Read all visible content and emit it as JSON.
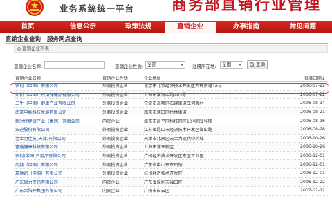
{
  "header": {
    "subtitle": "业务系统统一平台",
    "title": "商务部直销行业管理"
  },
  "nav": {
    "items": [
      {
        "label": "首页",
        "active": false
      },
      {
        "label": "信息公示",
        "active": false
      },
      {
        "label": "政策法规",
        "active": false
      },
      {
        "label": "直销企业",
        "active": true
      },
      {
        "label": "办事指南",
        "active": false
      },
      {
        "label": "常见问题",
        "active": false
      }
    ]
  },
  "section": {
    "title": "直销企业查询 | 服务网点查询",
    "crumb": "直销企业列表"
  },
  "search": {
    "name_label": "直销企业名称:",
    "type_label": "直销企业性质:",
    "type_value": "全部",
    "region_label": "注册所在地:",
    "region_value": "全国",
    "button_label": "查询"
  },
  "table": {
    "headers": [
      "直销企业名称",
      "直销企业性质",
      "企业地址",
      "批准日期↓"
    ],
    "rows": [
      [
        "安利（中国）有限公司",
        "外商投资企业",
        "北京市北京经济技术开发区西环南路18号",
        "2006-07-22"
      ],
      [
        "如新（中国）日用保健品有限公司",
        "外商投资企业",
        "上海市淮海中路283号",
        "2006-07-22"
      ],
      [
        "三生（中国）健康产业有限公司",
        "外商投资企业",
        "宁波市海曙区石碶街道车何渡村",
        "2006-08-14"
      ],
      [
        "南京中脉科技发展有限公司",
        "外商投资企业",
        "南京市浦口区桥林街道",
        "2006-08-21"
      ],
      [
        "新时代健康产业（集团）有限公司",
        "内资企业",
        "北京市昌平区科技园区10号院1号楼",
        "2006-08-16"
      ],
      [
        "双迪股份有限公司",
        "外商投资企业",
        "江苏省昆山市经济技术开发区嵩山路",
        "2006-08-28"
      ],
      [
        "金士力佳友(天津)有限公司",
        "外商投资企业",
        "天津市北辰区天士力现代中药城",
        "2006-10-26"
      ],
      [
        "富迪健康科技有限公司",
        "外商投资企业",
        "上海市浦东新区",
        "2006-10-26"
      ],
      [
        "安利(中国)日用品有限公司",
        "外商投资企业",
        "广州经济技术开发区东区工业区",
        "2006-12-01"
      ],
      [
        "尚赫（中国）有限公司",
        "外商投资企业",
        "广东省中山市东凤镇",
        "2006-12-01"
      ],
      [
        "玫琳凯（中国）有限公司",
        "外商投资企业",
        "杭州经济技术开发区",
        "2006-12-01"
      ],
      [
        "广东康力医药有限公司",
        "内资企业",
        "广东省深圳市福田区",
        "2006-12-22"
      ],
      [
        "广东太阳神集团有限公司",
        "内资企业",
        "广州市白云区",
        "2007-02-12"
      ]
    ]
  }
}
